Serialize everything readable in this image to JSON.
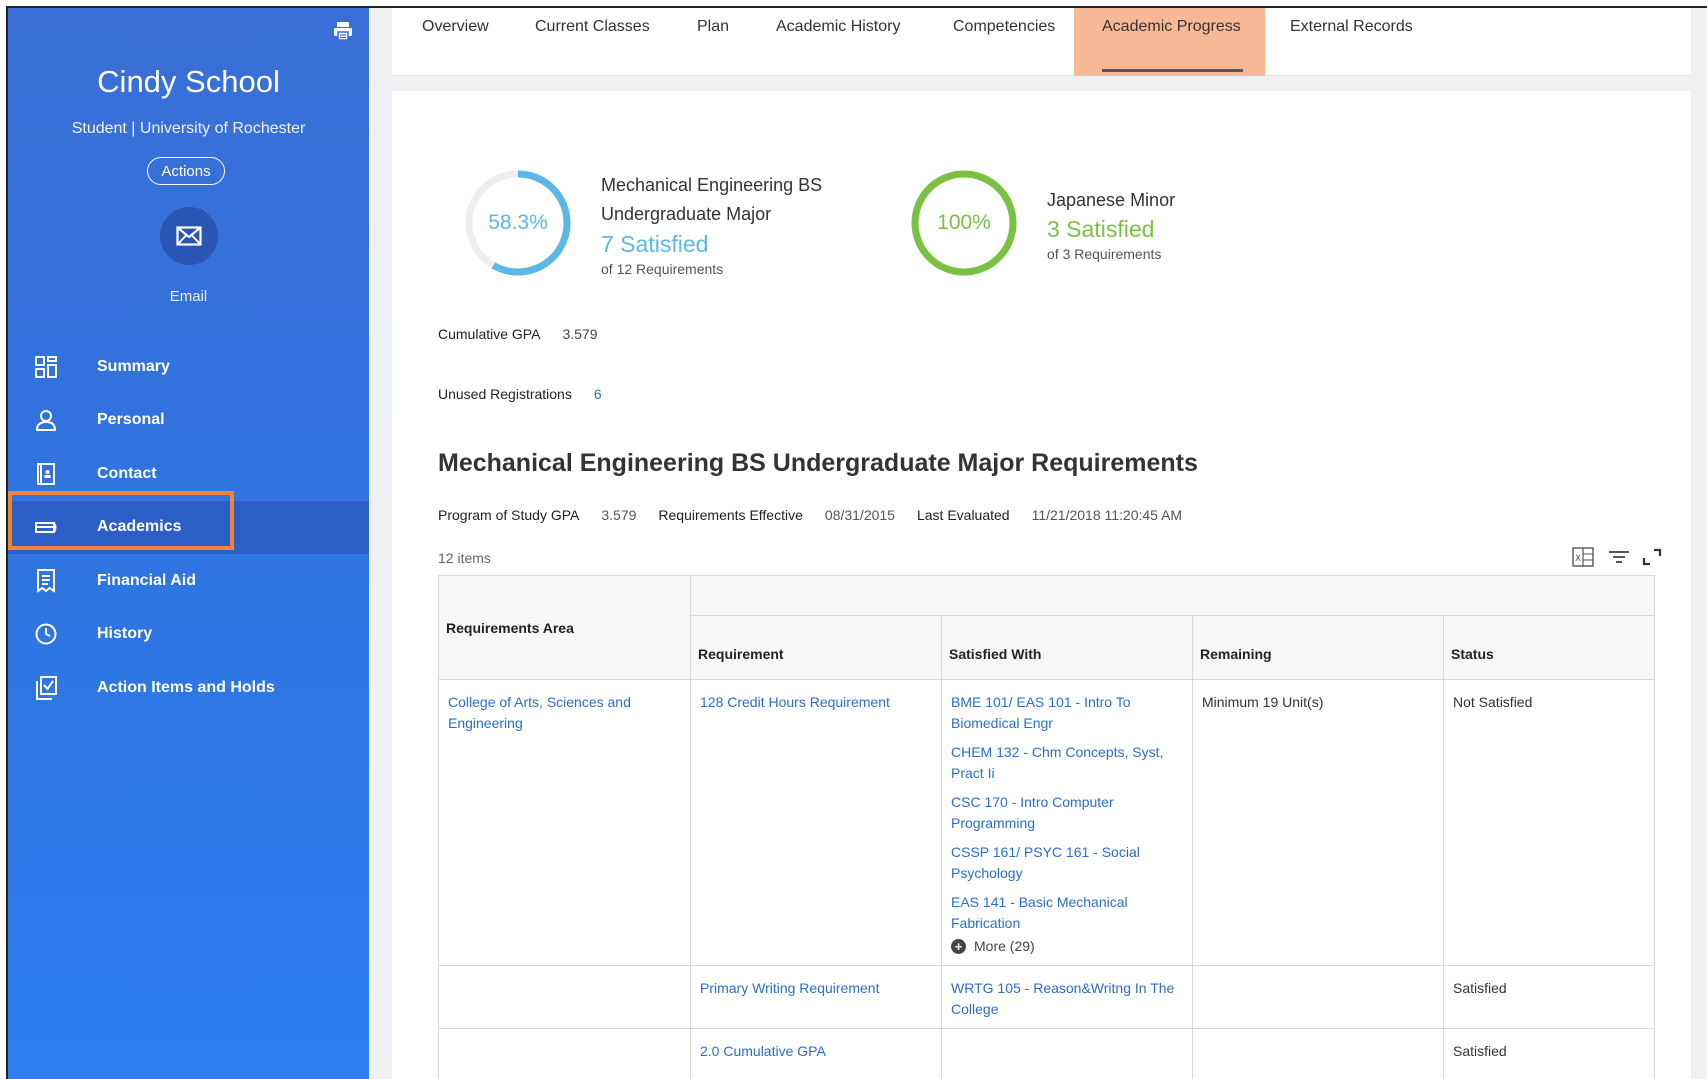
{
  "sidebar": {
    "name": "Cindy School",
    "subtitle": "Student | University of Rochester",
    "actions_label": "Actions",
    "email_label": "Email",
    "items": [
      {
        "label": "Summary",
        "icon": "summary-grid-icon"
      },
      {
        "label": "Personal",
        "icon": "person-icon"
      },
      {
        "label": "Contact",
        "icon": "contact-book-icon"
      },
      {
        "label": "Academics",
        "icon": "academics-icon",
        "active": true
      },
      {
        "label": "Financial Aid",
        "icon": "receipt-icon"
      },
      {
        "label": "History",
        "icon": "clock-icon"
      },
      {
        "label": "Action Items and Holds",
        "icon": "checklist-icon"
      }
    ]
  },
  "tabs": [
    {
      "label": "Overview"
    },
    {
      "label": "Current Classes"
    },
    {
      "label": "Plan"
    },
    {
      "label": "Academic History"
    },
    {
      "label": "Competencies"
    },
    {
      "label": "Academic Progress",
      "active": true
    },
    {
      "label": "External Records"
    }
  ],
  "progress": [
    {
      "percent_label": "58.3%",
      "fraction": 0.583,
      "title_line1": "Mechanical Engineering BS",
      "title_line2": "Undergraduate Major",
      "satisfied": "7 Satisfied",
      "of_text": "of 12 Requirements",
      "color": "#5bb8e4"
    },
    {
      "percent_label": "100%",
      "fraction": 1.0,
      "title_line1": "Japanese Minor",
      "satisfied": "3 Satisfied",
      "of_text": "of 3 Requirements",
      "color": "#7ac142"
    }
  ],
  "cumulative_gpa": {
    "label": "Cumulative GPA",
    "value": "3.579"
  },
  "unused_registrations": {
    "label": "Unused Registrations",
    "value": "6"
  },
  "section": {
    "title": "Mechanical Engineering BS Undergraduate Major Requirements",
    "program_gpa_label": "Program of Study GPA",
    "program_gpa_value": "3.579",
    "effective_label": "Requirements Effective",
    "effective_value": "08/31/2015",
    "evaluated_label": "Last Evaluated",
    "evaluated_value": "11/21/2018 11:20:45 AM",
    "items_count": "12 items"
  },
  "table": {
    "headers": {
      "area": "Requirements Area",
      "requirement": "Requirement",
      "satisfied_with": "Satisfied With",
      "remaining": "Remaining",
      "status": "Status"
    },
    "rows": [
      {
        "area": "College of Arts, Sciences and Engineering",
        "requirement": "128 Credit Hours Requirement",
        "satisfied_with": [
          "BME 101/ EAS 101 - Intro To Biomedical Engr",
          "CHEM 132 - Chm Concepts, Syst, Pract Ii",
          "CSC 170 - Intro Computer Programming",
          "CSSP 161/ PSYC 161 - Social Psychology",
          "EAS 141 - Basic Mechanical Fabrication"
        ],
        "more": "More (29)",
        "remaining": "Minimum 19 Unit(s)",
        "status": "Not Satisfied"
      },
      {
        "area": "",
        "requirement": "Primary Writing Requirement",
        "satisfied_with": [
          "WRTG 105 - Reason&Writng In The College"
        ],
        "remaining": "",
        "status": "Satisfied"
      },
      {
        "area": "",
        "requirement": "2.0 Cumulative GPA",
        "satisfied_with": [],
        "remaining": "",
        "status": "Satisfied"
      }
    ]
  },
  "colors": {
    "sidebar_top": "#3a6ed6",
    "sidebar_bottom": "#2d7ef0",
    "active_tab_bg": "#f7b995",
    "highlight_outline": "#f0843a",
    "link": "#2b6fc9"
  }
}
